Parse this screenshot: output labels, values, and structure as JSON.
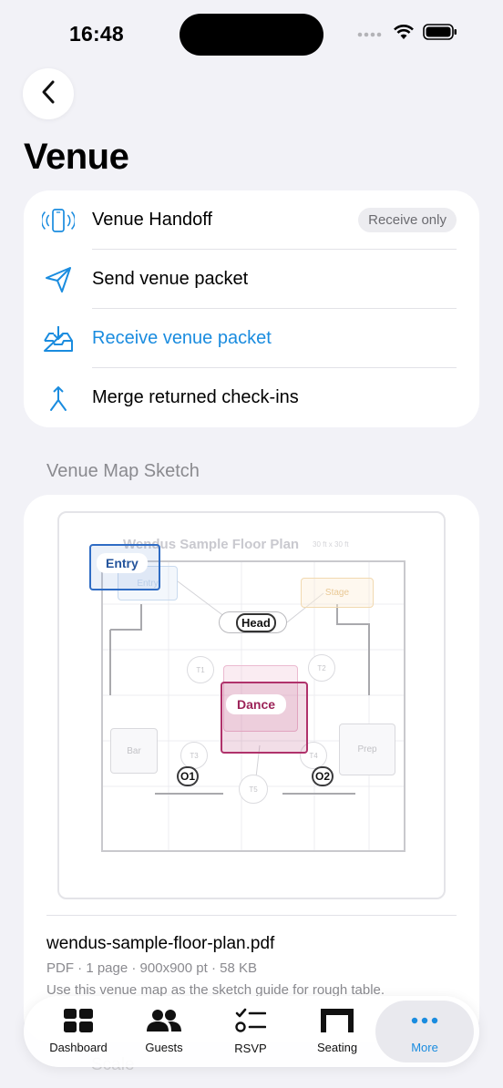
{
  "status_bar": {
    "time": "16:48"
  },
  "header": {
    "title": "Venue"
  },
  "actions": {
    "handoff": {
      "label": "Venue Handoff",
      "badge": "Receive only"
    },
    "send": {
      "label": "Send venue packet"
    },
    "receive": {
      "label": "Receive venue packet"
    },
    "merge": {
      "label": "Merge returned check-ins"
    }
  },
  "map_section": {
    "header": "Venue Map Sketch",
    "floor_plan": {
      "title": "Wendus Sample Floor Plan",
      "subtitle": "30 ft x 30 ft",
      "entry_ghost": "Entry",
      "entry": "Entry",
      "stage": "Stage",
      "head": "Head",
      "dance": "Dance",
      "bar": "Bar",
      "prep": "Prep",
      "tables": {
        "t1": "T1",
        "t2": "T2",
        "t3": "T3",
        "t4": "T4",
        "t5": "T5",
        "o1": "O1",
        "o2": "O2"
      }
    },
    "file": {
      "name": "wendus-sample-floor-plan.pdf",
      "meta": "PDF · 1 page · 900x900 pt · 58 KB",
      "description": "Use this venue map as the sketch guide for rough table."
    }
  },
  "faded_rows": {
    "scale": "Scale",
    "dims": "900×900 pt"
  },
  "tab_bar": {
    "items": [
      {
        "label": "Dashboard",
        "icon": "dashboard-icon"
      },
      {
        "label": "Guests",
        "icon": "guests-icon"
      },
      {
        "label": "RSVP",
        "icon": "rsvp-icon"
      },
      {
        "label": "Seating",
        "icon": "seating-icon"
      },
      {
        "label": "More",
        "icon": "more-icon"
      }
    ],
    "active": "More"
  },
  "colors": {
    "accent": "#1a8cdf",
    "entry": "#2f6cc4",
    "dance": "#b0326b",
    "background": "#f2f2f7"
  }
}
